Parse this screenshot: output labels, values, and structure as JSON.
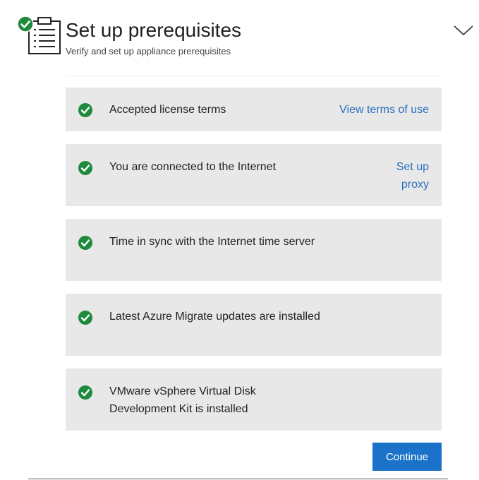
{
  "header": {
    "title": "Set up prerequisites",
    "subtitle": "Verify and set up appliance prerequisites",
    "status_icon": "check-circle-icon",
    "section_icon": "clipboard-list-icon",
    "collapse_icon": "chevron-down-icon"
  },
  "prerequisites": [
    {
      "label": "Accepted license terms",
      "status": "complete",
      "link": "View terms of use"
    },
    {
      "label": "You are connected to the Internet",
      "status": "complete",
      "link": "Set up proxy"
    },
    {
      "label": "Time in sync with the Internet time server",
      "status": "complete"
    },
    {
      "label": "Latest Azure Migrate updates are installed",
      "status": "complete"
    },
    {
      "label": "VMware vSphere Virtual Disk Development Kit is installed",
      "status": "complete"
    }
  ],
  "actions": {
    "continue_label": "Continue"
  },
  "colors": {
    "success": "#1e8a3e",
    "link": "#2b6fbd",
    "primary_button": "#1a73c8",
    "row_background": "#e8e8e8"
  }
}
